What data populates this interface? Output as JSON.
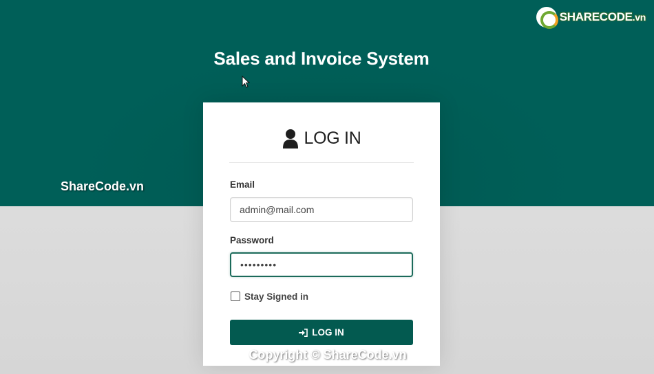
{
  "brand": {
    "logo_text": "SHARECODE",
    "logo_suffix": ".vn",
    "watermark_side": "ShareCode.vn",
    "watermark_footer": "Copyright © ShareCode.vn"
  },
  "app": {
    "title": "Sales and Invoice System"
  },
  "login": {
    "title": "LOG IN",
    "email_label": "Email",
    "email_value": "admin@mail.com",
    "password_label": "Password",
    "password_value": "•••••••••",
    "remember_label": "Stay Signed in",
    "remember_checked": false,
    "button_label": "LOG IN"
  },
  "icons": {
    "header": "user-icon",
    "button": "sign-in-icon"
  },
  "colors": {
    "primary": "#035a50",
    "band": "#005c55",
    "focus_border": "#1b6a5a"
  }
}
